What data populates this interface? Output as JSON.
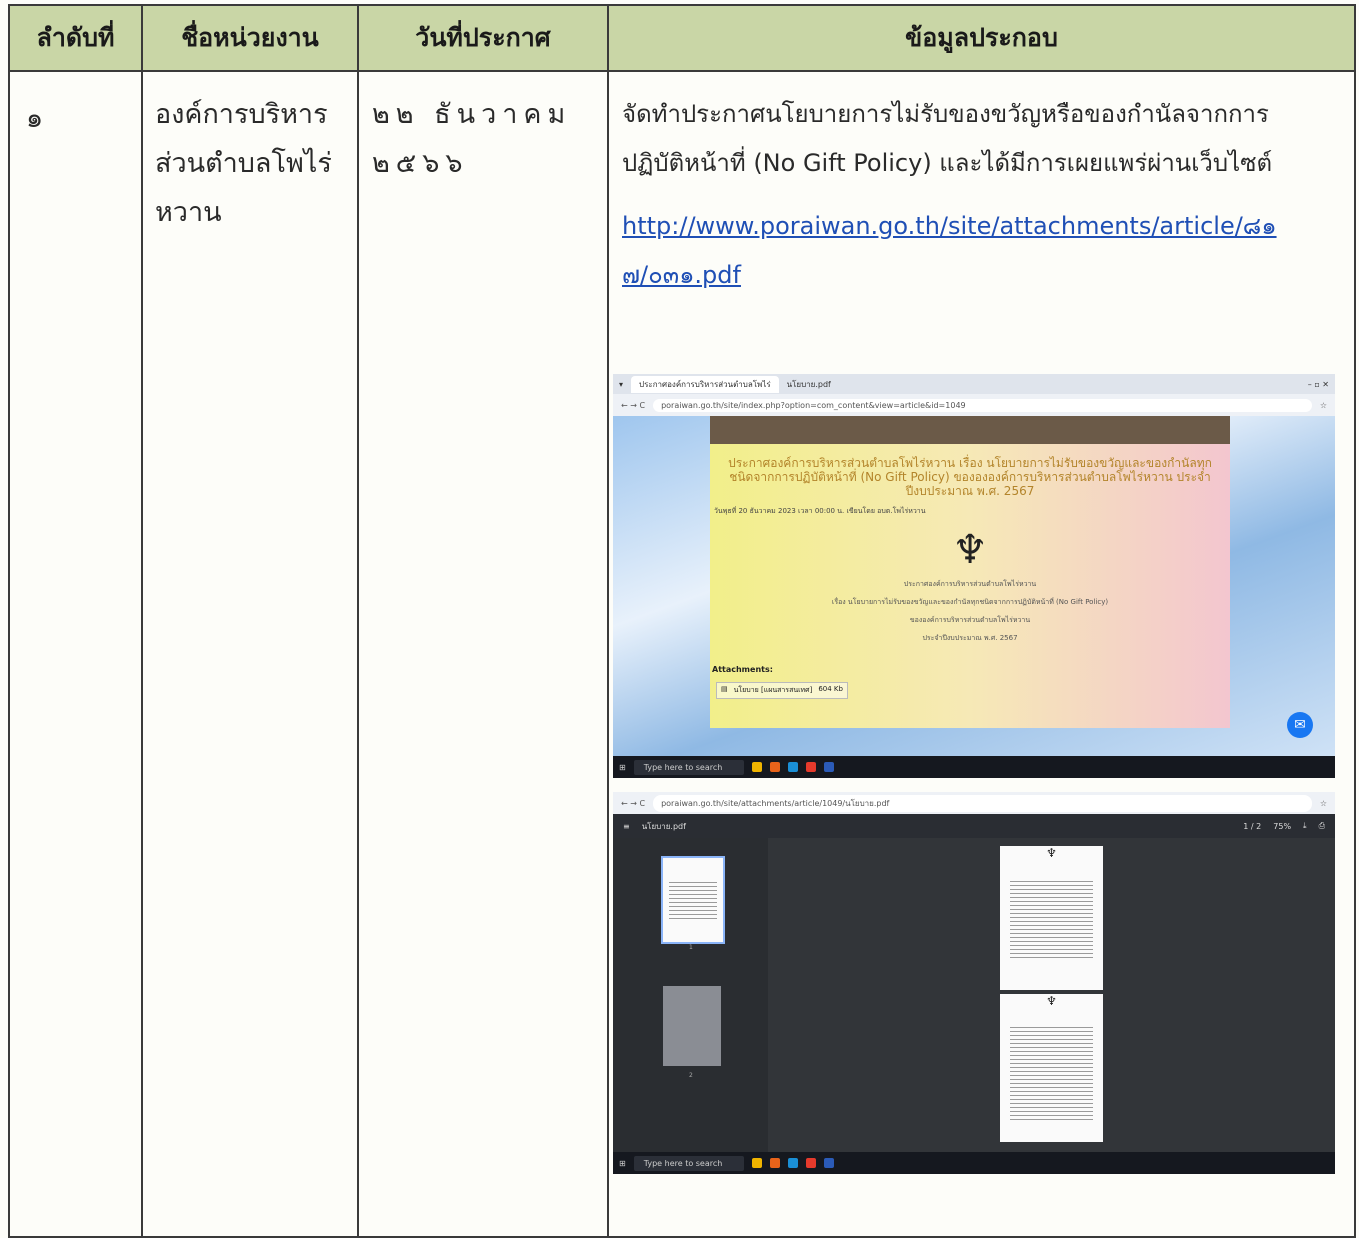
{
  "header": {
    "col1": "ลำดับที่",
    "col2": "ชื่อหน่วยงาน",
    "col3": "วันที่ประกาศ",
    "col4": "ข้อมูลประกอบ"
  },
  "row1": {
    "number": "๑",
    "agency_line1": "องค์การบริหาร",
    "agency_line2": "ส่วนตำบลโพไร่",
    "agency_line3": "หวาน",
    "date_line1": "๒๒ ธันวาคม",
    "date_line2": "๒๕๖๖",
    "info_line1": "จัดทำประกาศนโยบายการไม่รับของขวัญหรือของกำนัลจากการ",
    "info_line2": "ปฏิบัติหน้าที่ (No Gift Policy) และได้มีการเผยแพร่ผ่านเว็บไซต์",
    "link_line1": "http://www.poraiwan.go.th/site/attachments/article/๘๑",
    "link_line2": "๗/๐๓๑.pdf"
  },
  "screenshot1": {
    "tab1": "ประกาศองค์การบริหารส่วนตำบลโพไร่",
    "tab2": "นโยบาย.pdf",
    "url": "poraiwan.go.th/site/index.php?option=com_content&view=article&id=1049",
    "title": "ประกาศองค์การบริหารส่วนตำบลโพไร่หวาน เรื่อง นโยบายการไม่รับของขวัญและของกำนัลทุกชนิดจากการปฏิบัติหน้าที่ (No Gift Policy) ของององค์การบริหารส่วนตำบลโพไร่หวาน ประจำปีงบประมาณ พ.ศ. 2567",
    "meta": "วันพุธที่ 20 ธันวาคม 2023 เวลา 00:00 น. เขียนโดย อบต.โพไร่หวาน",
    "notice_l1": "ประกาศองค์การบริหารส่วนตำบลโพไร่หวาน",
    "notice_l2": "เรื่อง นโยบายการไม่รับของขวัญและของกำนัลทุกชนิดจากการปฏิบัติหน้าที่ (No Gift Policy)",
    "notice_l3": "ขององค์การบริหารส่วนตำบลโพไร่หวาน",
    "notice_l4": "ประจำปีงบประมาณ พ.ศ. 2567",
    "attachments_label": "Attachments:",
    "attachment_file": "นโยบาย [แผนสารสนเทศ]",
    "attachment_size": "604 Kb",
    "taskbar_search": "Type here to search"
  },
  "screenshot2": {
    "url": "poraiwan.go.th/site/attachments/article/1049/นโยบาย.pdf",
    "pdf_name": "นโยบาย.pdf",
    "page_indicator": "1 / 2",
    "zoom": "75%",
    "thumb1": "1",
    "thumb2": "2",
    "taskbar_search": "Type here to search"
  },
  "colors": {
    "header_bg": "#c9d6a6",
    "link": "#1f4fb5",
    "notice_title": "#b3842a"
  }
}
